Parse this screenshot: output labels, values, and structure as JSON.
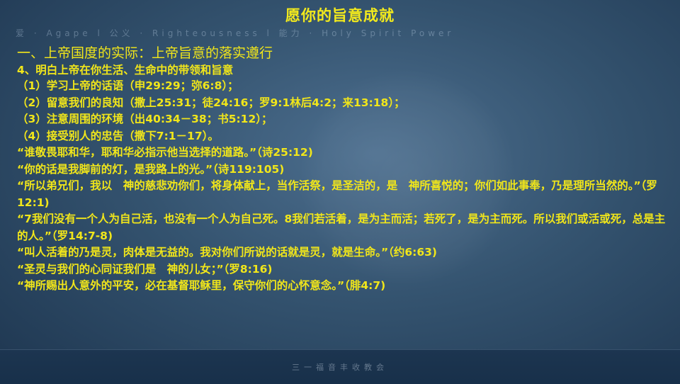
{
  "title": "愿你的旨意成就",
  "banner": "爱 · Agape   l   公义 · Righteousness   l   能力 · Holy Spirit Power",
  "section_title": "一、上帝国度的实际：上帝旨意的落实遵行",
  "subheading": "4、明白上帝在你生活、生命中的带领和旨意",
  "lines": [
    "（1）学习上帝的话语（申29:29；弥6:8）；",
    "（2）留意我们的良知（撒上25:31；徒24:16；罗9:1林后4:2；来13:18）；",
    "（3）注意周围的环境（出40:34－38；书5:12）；",
    "（4）接受别人的忠告（撒下7:1－17）。",
    "“谁敬畏耶和华，耶和华必指示他当选择的道路。”（诗25:12)",
    "“你的话是我脚前的灯，是我路上的光。”（诗119:105)",
    "“所以弟兄们，我以　神的慈悲劝你们，将身体献上，当作活祭，是圣洁的，是　神所喜悦的；你们如此事奉，乃是理所当然的。”（罗12:1)",
    "“7我们没有一个人为自己活，也没有一个人为自己死。8我们若活着，是为主而活；若死了，是为主而死。所以我们或活或死，总是主的人。”（罗14:7-8)",
    "“叫人活着的乃是灵，肉体是无益的。我对你们所说的话就是灵，就是生命。”（约6:63)",
    "“圣灵与我们的心同证我们是　神的儿女；”（罗8:16)",
    "“神所赐出人意外的平安，必在基督耶稣里，保守你们的心怀意念。”（腓4:7)"
  ],
  "footer": "三一福音丰收教会",
  "colors": {
    "text": "#f1e61a",
    "background": "#34536f"
  }
}
